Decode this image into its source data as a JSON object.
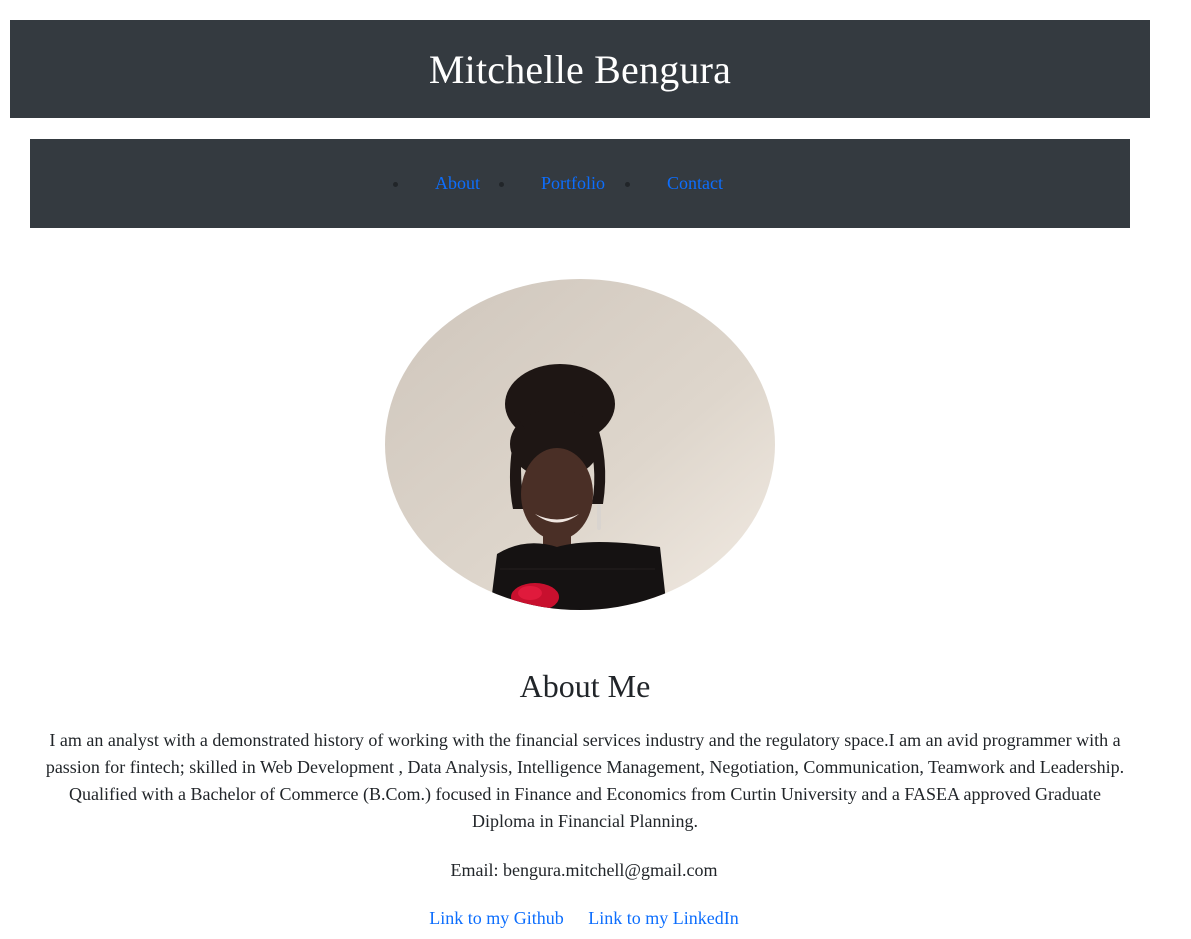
{
  "header": {
    "title": "Mitchelle Bengura"
  },
  "nav": {
    "items": [
      {
        "label": "About"
      },
      {
        "label": "Portfolio"
      },
      {
        "label": "Contact"
      }
    ]
  },
  "profile": {
    "photo_icon": "profile-photo"
  },
  "about": {
    "heading": "About Me",
    "bio": "I am an analyst with a demonstrated history of working with the financial services industry and the regulatory space.I am an avid programmer with a passion for fintech; skilled in Web Development , Data Analysis, Intelligence Management, Negotiation, Communication, Teamwork and Leadership. Qualified with a Bachelor of Commerce (B.Com.) focused in Finance and Economics from Curtin University and a FASEA approved Graduate Diploma in Financial Planning.",
    "email": "Email: bengura.mitchell@gmail.com",
    "links": [
      {
        "label": "Link to my Github"
      },
      {
        "label": "Link to my LinkedIn"
      }
    ]
  },
  "colors": {
    "dark_bar": "#343a40",
    "link": "#0d6efd",
    "text": "#212529"
  }
}
